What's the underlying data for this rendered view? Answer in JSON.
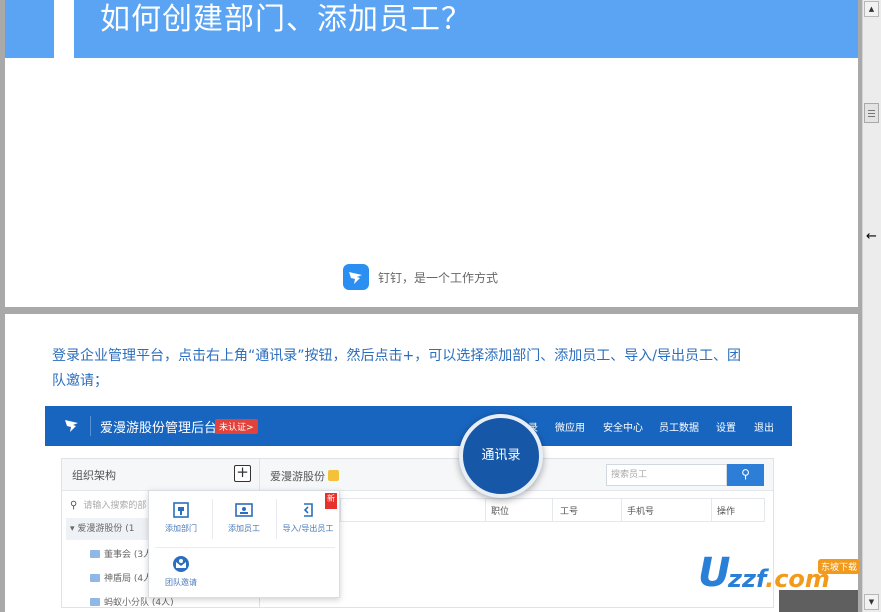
{
  "page1": {
    "title": "如何创建部门、添加员工？",
    "slogan": "钉钉，是一个工作方式"
  },
  "page2": {
    "intro": "登录企业管理平台，点击右上角“通讯录”按钮，然后点击+，可以选择添加部门、添加员工、导入/导出员工、团队邀请；"
  },
  "screenshot": {
    "brand": "爱漫游股份管理后台",
    "cert_badge": "未认证>",
    "nav": [
      "录",
      "微应用",
      "安全中心",
      "员工数据",
      "设置",
      "退出"
    ],
    "magnifier_label": "通讯录",
    "left": {
      "title": "组织架构",
      "search_placeholder": "请输入搜索的部",
      "root": "爱漫游股份 (1",
      "items": [
        "董事会 (3人",
        "神盾局 (4人",
        "蚂蚁小分队 (4人)"
      ]
    },
    "right": {
      "company": "爱漫游股份",
      "search_placeholder": "搜索员工",
      "columns": [
        "职位",
        "工号",
        "手机号",
        "操作"
      ]
    },
    "popup": {
      "items": [
        "添加部门",
        "添加员工",
        "导入/导出员工",
        "团队邀请"
      ],
      "hot_tag": "新"
    }
  },
  "watermark": {
    "u": "U",
    "zzf": "zzf",
    "com": ".com",
    "tag": "东坡下载"
  },
  "colors": {
    "title_bar": "#5ba4f3",
    "intro_text": "#2b6ebd",
    "console_header": "#1865c0",
    "accent_red": "#e1433c"
  }
}
